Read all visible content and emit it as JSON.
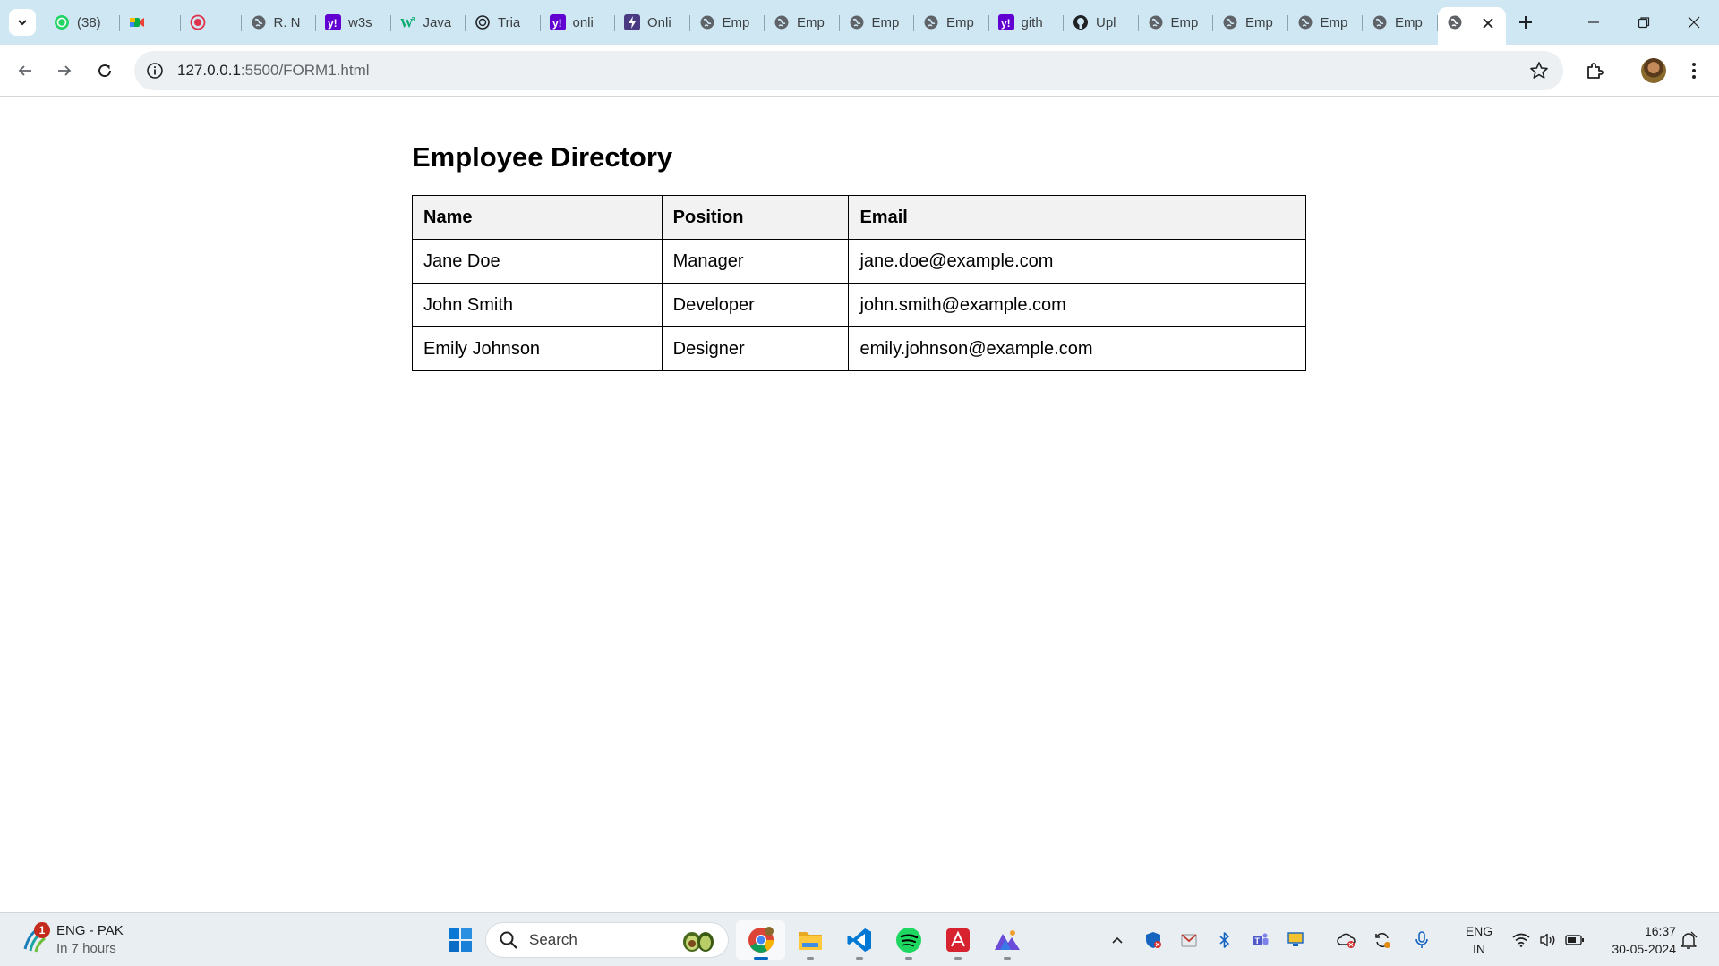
{
  "browser": {
    "tabs": [
      {
        "label": "(38)",
        "icon": "whatsapp-icon"
      },
      {
        "label": "",
        "icon": "google-meet-icon"
      },
      {
        "label": "",
        "icon": "record-icon"
      },
      {
        "label": "R. N",
        "icon": "globe-icon"
      },
      {
        "label": "w3s",
        "icon": "yahoo-icon"
      },
      {
        "label": "Java",
        "icon": "w-logo-icon"
      },
      {
        "label": "Tria",
        "icon": "chatgpt-icon"
      },
      {
        "label": "onli",
        "icon": "yahoo-icon"
      },
      {
        "label": "Onli",
        "icon": "bolt-icon"
      },
      {
        "label": "Emp",
        "icon": "globe-icon"
      },
      {
        "label": "Emp",
        "icon": "globe-icon"
      },
      {
        "label": "Emp",
        "icon": "globe-icon"
      },
      {
        "label": "Emp",
        "icon": "globe-icon"
      },
      {
        "label": "gith",
        "icon": "yahoo-icon"
      },
      {
        "label": "Upl",
        "icon": "github-icon"
      },
      {
        "label": "Emp",
        "icon": "globe-icon"
      },
      {
        "label": "Emp",
        "icon": "globe-icon"
      },
      {
        "label": "Emp",
        "icon": "globe-icon"
      },
      {
        "label": "Emp",
        "icon": "globe-icon"
      }
    ],
    "active_tab": {
      "icon": "globe-icon"
    },
    "address": {
      "host": "127.0.0.1",
      "path": ":5500/FORM1.html"
    }
  },
  "page": {
    "title": "Employee Directory",
    "table": {
      "headers": [
        "Name",
        "Position",
        "Email"
      ],
      "rows": [
        [
          "Jane Doe",
          "Manager",
          "jane.doe@example.com"
        ],
        [
          "John Smith",
          "Developer",
          "john.smith@example.com"
        ],
        [
          "Emily Johnson",
          "Designer",
          "emily.johnson@example.com"
        ]
      ]
    }
  },
  "taskbar": {
    "weather": {
      "badge": "1",
      "line1": "ENG - PAK",
      "line2": "In 7 hours"
    },
    "search_label": "Search",
    "language": {
      "line1": "ENG",
      "line2": "IN"
    },
    "clock": {
      "time": "16:37",
      "date": "30-05-2024"
    }
  },
  "colors": {
    "tabstrip": "#cfe7f3",
    "omnibox": "#edf0f2",
    "table_header_bg": "#f2f2f2",
    "taskbar": "#e9eef3",
    "accent": "#0067c0"
  }
}
